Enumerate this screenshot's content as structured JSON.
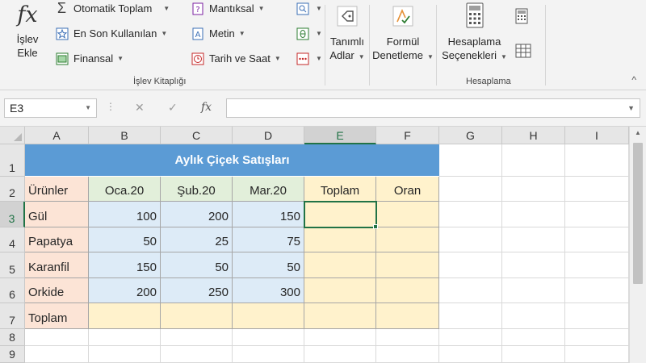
{
  "ribbon": {
    "insert_function": {
      "icon": "fx-icon",
      "symbol": "fx",
      "line1": "İşlev",
      "line2": "Ekle"
    },
    "autosum": {
      "icon": "sigma-icon",
      "label": "Otomatik Toplam"
    },
    "recent": {
      "icon": "star-icon",
      "label": "En Son Kullanılan"
    },
    "financial": {
      "icon": "financial-icon",
      "label": "Finansal"
    },
    "logical": {
      "icon": "question-book-icon",
      "label": "Mantıksal"
    },
    "text": {
      "icon": "text-icon",
      "label": "Metin"
    },
    "datetime": {
      "icon": "clock-icon",
      "label": "Tarih ve Saat"
    },
    "lookup": {
      "icon": "lookup-icon"
    },
    "math": {
      "icon": "theta-icon"
    },
    "more": {
      "icon": "more-functions-icon"
    },
    "library_group": "İşlev Kitaplığı",
    "defined_names": {
      "icon": "tag-icon",
      "line1": "Tanımlı",
      "line2": "Adlar"
    },
    "formula_auditing": {
      "icon": "auditing-icon",
      "line1": "Formül",
      "line2": "Denetleme"
    },
    "calc_options": {
      "icon": "calculator-icon",
      "line1": "Hesaplama",
      "line2": "Seçenekleri"
    },
    "calc_now": {
      "icon": "calculator-small-icon"
    },
    "calc_sheet": {
      "icon": "sheet-calc-icon"
    },
    "calc_group": "Hesaplama",
    "collapse": "^"
  },
  "formula_bar": {
    "name_box": "E3",
    "cancel": "✕",
    "enter": "✓",
    "fx": "fx",
    "value": ""
  },
  "sheet": {
    "columns": [
      "A",
      "B",
      "C",
      "D",
      "E",
      "F",
      "G",
      "H",
      "I"
    ],
    "rows": [
      "1",
      "2",
      "3",
      "4",
      "5",
      "6",
      "7",
      "8",
      "9"
    ],
    "selected_cell": "E3",
    "title": "Aylık Çiçek Satışları",
    "headers": [
      "Ürünler",
      "Oca.20",
      "Şub.20",
      "Mar.20",
      "Toplam",
      "Oran"
    ],
    "data": [
      {
        "product": "Gül",
        "values": [
          "100",
          "200",
          "150"
        ]
      },
      {
        "product": "Papatya",
        "values": [
          "50",
          "25",
          "75"
        ]
      },
      {
        "product": "Karanfil",
        "values": [
          "150",
          "50",
          "50"
        ]
      },
      {
        "product": "Orkide",
        "values": [
          "200",
          "250",
          "300"
        ]
      }
    ],
    "total_label": "Toplam"
  },
  "colors": {
    "title_fill": "#5b9bd5",
    "product_fill": "#fce4d6",
    "header_fill": "#e2efda",
    "value_fill": "#ddebf7",
    "total_fill": "#fff2cc",
    "selection": "#217346"
  }
}
